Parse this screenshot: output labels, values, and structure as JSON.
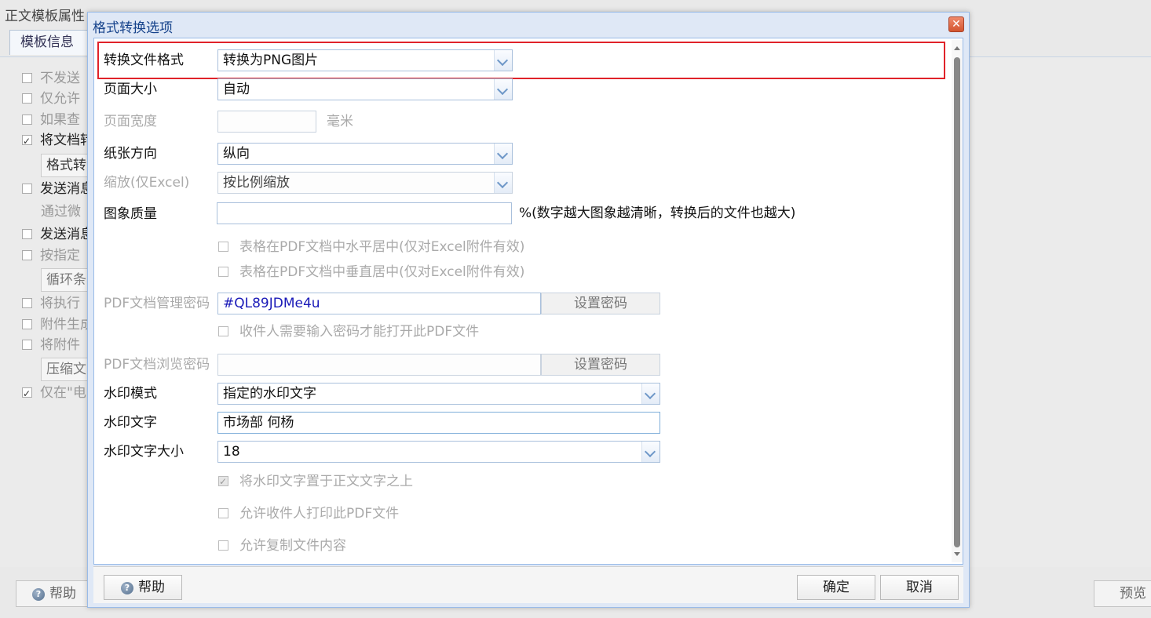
{
  "background": {
    "title": "正文模板属性",
    "tab": "模板信息",
    "rows": [
      "不发送",
      "仅允许",
      "如果查",
      "将文档转",
      "格式转",
      "发送消息",
      "通过微",
      "发送消息",
      "按指定",
      "循环条",
      "将执行",
      "附件生成",
      "将附件",
      "压缩文",
      "仅在\"电"
    ],
    "help_label": "帮助",
    "preview_label": "预览"
  },
  "dialog": {
    "title": "格式转换选项",
    "close_icon": "close-icon",
    "convert_format": {
      "label": "转换文件格式",
      "value": "转换为PNG图片"
    },
    "page_size": {
      "label": "页面大小",
      "value": "自动"
    },
    "page_width": {
      "label": "页面宽度",
      "value": "",
      "unit": "毫米"
    },
    "orientation": {
      "label": "纸张方向",
      "value": "纵向"
    },
    "scale": {
      "label": "缩放(仅Excel)",
      "value": "按比例缩放"
    },
    "image_quality": {
      "label": "图象质量",
      "value": "",
      "hint": "%(数字越大图象越清晰，转换后的文件也越大)"
    },
    "center_h": "表格在PDF文档中水平居中(仅对Excel附件有效)",
    "center_v": "表格在PDF文档中垂直居中(仅对Excel附件有效)",
    "admin_password": {
      "label": "PDF文档管理密码",
      "value": "#QL89JDMe4u",
      "button": "设置密码"
    },
    "require_password": "收件人需要输入密码才能打开此PDF文件",
    "view_password": {
      "label": "PDF文档浏览密码",
      "value": "",
      "button": "设置密码"
    },
    "watermark_mode": {
      "label": "水印模式",
      "value": "指定的水印文字"
    },
    "watermark_text": {
      "label": "水印文字",
      "value": "市场部 何杨"
    },
    "watermark_size": {
      "label": "水印文字大小",
      "value": "18"
    },
    "watermark_above": "将水印文字置于正文文字之上",
    "allow_print": "允许收件人打印此PDF文件",
    "allow_copy": "允许复制文件内容",
    "footer": {
      "help": "帮助",
      "ok": "确定",
      "cancel": "取消"
    }
  },
  "colors": {
    "highlight": "#e0232a",
    "password_text": "#1a1ab8",
    "title_text": "#15428b"
  }
}
